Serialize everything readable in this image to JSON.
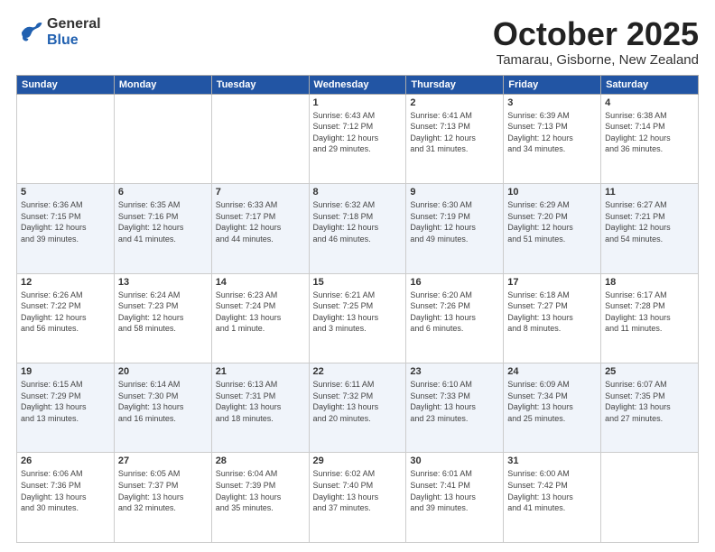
{
  "header": {
    "logo_general": "General",
    "logo_blue": "Blue",
    "month_title": "October 2025",
    "location": "Tamarau, Gisborne, New Zealand"
  },
  "weekdays": [
    "Sunday",
    "Monday",
    "Tuesday",
    "Wednesday",
    "Thursday",
    "Friday",
    "Saturday"
  ],
  "weeks": [
    [
      {
        "day": "",
        "info": ""
      },
      {
        "day": "",
        "info": ""
      },
      {
        "day": "",
        "info": ""
      },
      {
        "day": "1",
        "info": "Sunrise: 6:43 AM\nSunset: 7:12 PM\nDaylight: 12 hours\nand 29 minutes."
      },
      {
        "day": "2",
        "info": "Sunrise: 6:41 AM\nSunset: 7:13 PM\nDaylight: 12 hours\nand 31 minutes."
      },
      {
        "day": "3",
        "info": "Sunrise: 6:39 AM\nSunset: 7:13 PM\nDaylight: 12 hours\nand 34 minutes."
      },
      {
        "day": "4",
        "info": "Sunrise: 6:38 AM\nSunset: 7:14 PM\nDaylight: 12 hours\nand 36 minutes."
      }
    ],
    [
      {
        "day": "5",
        "info": "Sunrise: 6:36 AM\nSunset: 7:15 PM\nDaylight: 12 hours\nand 39 minutes."
      },
      {
        "day": "6",
        "info": "Sunrise: 6:35 AM\nSunset: 7:16 PM\nDaylight: 12 hours\nand 41 minutes."
      },
      {
        "day": "7",
        "info": "Sunrise: 6:33 AM\nSunset: 7:17 PM\nDaylight: 12 hours\nand 44 minutes."
      },
      {
        "day": "8",
        "info": "Sunrise: 6:32 AM\nSunset: 7:18 PM\nDaylight: 12 hours\nand 46 minutes."
      },
      {
        "day": "9",
        "info": "Sunrise: 6:30 AM\nSunset: 7:19 PM\nDaylight: 12 hours\nand 49 minutes."
      },
      {
        "day": "10",
        "info": "Sunrise: 6:29 AM\nSunset: 7:20 PM\nDaylight: 12 hours\nand 51 minutes."
      },
      {
        "day": "11",
        "info": "Sunrise: 6:27 AM\nSunset: 7:21 PM\nDaylight: 12 hours\nand 54 minutes."
      }
    ],
    [
      {
        "day": "12",
        "info": "Sunrise: 6:26 AM\nSunset: 7:22 PM\nDaylight: 12 hours\nand 56 minutes."
      },
      {
        "day": "13",
        "info": "Sunrise: 6:24 AM\nSunset: 7:23 PM\nDaylight: 12 hours\nand 58 minutes."
      },
      {
        "day": "14",
        "info": "Sunrise: 6:23 AM\nSunset: 7:24 PM\nDaylight: 13 hours\nand 1 minute."
      },
      {
        "day": "15",
        "info": "Sunrise: 6:21 AM\nSunset: 7:25 PM\nDaylight: 13 hours\nand 3 minutes."
      },
      {
        "day": "16",
        "info": "Sunrise: 6:20 AM\nSunset: 7:26 PM\nDaylight: 13 hours\nand 6 minutes."
      },
      {
        "day": "17",
        "info": "Sunrise: 6:18 AM\nSunset: 7:27 PM\nDaylight: 13 hours\nand 8 minutes."
      },
      {
        "day": "18",
        "info": "Sunrise: 6:17 AM\nSunset: 7:28 PM\nDaylight: 13 hours\nand 11 minutes."
      }
    ],
    [
      {
        "day": "19",
        "info": "Sunrise: 6:15 AM\nSunset: 7:29 PM\nDaylight: 13 hours\nand 13 minutes."
      },
      {
        "day": "20",
        "info": "Sunrise: 6:14 AM\nSunset: 7:30 PM\nDaylight: 13 hours\nand 16 minutes."
      },
      {
        "day": "21",
        "info": "Sunrise: 6:13 AM\nSunset: 7:31 PM\nDaylight: 13 hours\nand 18 minutes."
      },
      {
        "day": "22",
        "info": "Sunrise: 6:11 AM\nSunset: 7:32 PM\nDaylight: 13 hours\nand 20 minutes."
      },
      {
        "day": "23",
        "info": "Sunrise: 6:10 AM\nSunset: 7:33 PM\nDaylight: 13 hours\nand 23 minutes."
      },
      {
        "day": "24",
        "info": "Sunrise: 6:09 AM\nSunset: 7:34 PM\nDaylight: 13 hours\nand 25 minutes."
      },
      {
        "day": "25",
        "info": "Sunrise: 6:07 AM\nSunset: 7:35 PM\nDaylight: 13 hours\nand 27 minutes."
      }
    ],
    [
      {
        "day": "26",
        "info": "Sunrise: 6:06 AM\nSunset: 7:36 PM\nDaylight: 13 hours\nand 30 minutes."
      },
      {
        "day": "27",
        "info": "Sunrise: 6:05 AM\nSunset: 7:37 PM\nDaylight: 13 hours\nand 32 minutes."
      },
      {
        "day": "28",
        "info": "Sunrise: 6:04 AM\nSunset: 7:39 PM\nDaylight: 13 hours\nand 35 minutes."
      },
      {
        "day": "29",
        "info": "Sunrise: 6:02 AM\nSunset: 7:40 PM\nDaylight: 13 hours\nand 37 minutes."
      },
      {
        "day": "30",
        "info": "Sunrise: 6:01 AM\nSunset: 7:41 PM\nDaylight: 13 hours\nand 39 minutes."
      },
      {
        "day": "31",
        "info": "Sunrise: 6:00 AM\nSunset: 7:42 PM\nDaylight: 13 hours\nand 41 minutes."
      },
      {
        "day": "",
        "info": ""
      }
    ]
  ]
}
